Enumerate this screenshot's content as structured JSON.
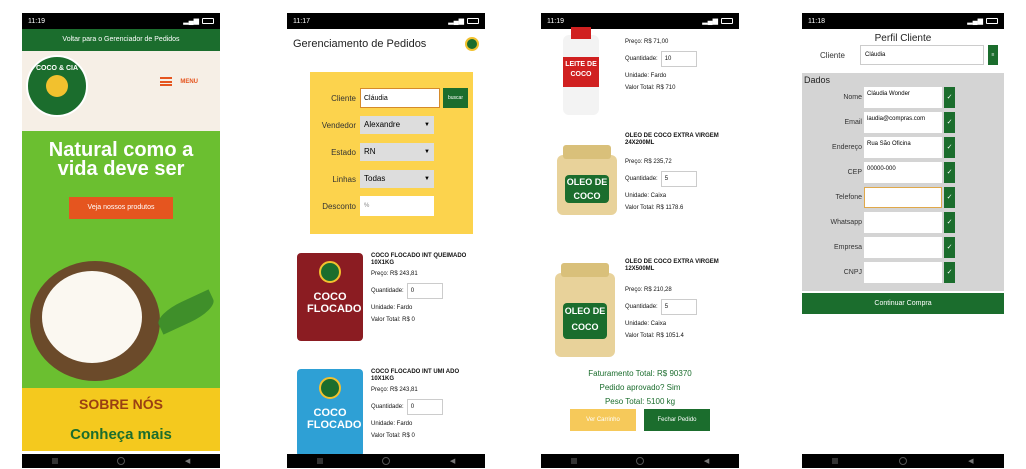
{
  "colors": {
    "brand_green": "#1b6d2d",
    "orange": "#e5551f",
    "yellow": "#fcd34d",
    "lime": "#6bbf30"
  },
  "screen1": {
    "status_time": "11:19",
    "banner": "Voltar para o Gerenciador de Pedidos",
    "logo_text": "COCO & CIA",
    "menu_label": "MENU",
    "headline": "Natural como a vida deve ser",
    "cta": "Veja nossos produtos",
    "sobre": "SOBRE NÓS",
    "conheca": "Conheça mais"
  },
  "screen2": {
    "status_time": "11:17",
    "title": "Gerenciamento de Pedidos",
    "form": {
      "cliente_label": "Cliente",
      "cliente_value": "Cláudia",
      "buscar": "buscar",
      "vendedor_label": "Vendedor",
      "vendedor_value": "Alexandre",
      "estado_label": "Estado",
      "estado_value": "RN",
      "linhas_label": "Linhas",
      "linhas_value": "Todas",
      "desconto_label": "Desconto",
      "desconto_placeholder": "%"
    },
    "products": [
      {
        "name": "COCO FLOCADO INT QUEIMADO 10X1KG",
        "pkg": "COCO FLOCADO",
        "preco": "Preço: R$ 243,81",
        "qtd_label": "Quantidade:",
        "qtd": "0",
        "unidade": "Unidade: Fardo",
        "total": "Valor Total: R$  0"
      },
      {
        "name": "COCO FLOCADO INT UMI ADO 10X1KG",
        "pkg": "COCO FLOCADO",
        "preco": "Preço: R$ 243,81",
        "qtd_label": "Quantidade:",
        "qtd": "0",
        "unidade": "Unidade: Fardo",
        "total": "Valor Total: R$  0"
      }
    ]
  },
  "screen3": {
    "status_time": "11:19",
    "products": [
      {
        "name": "",
        "pkg": "LEITE DE COCO",
        "preco": "Preço: R$ 71,00",
        "qtd_label": "Quantidade:",
        "qtd": "10",
        "unidade": "Unidade: Fardo",
        "total": "Valor Total: R$  710"
      },
      {
        "name": "OLEO DE COCO EXTRA VIRGEM 24X200ML",
        "pkg": "OLEO DE COCO",
        "preco": "Preço: R$ 235,72",
        "qtd_label": "Quantidade:",
        "qtd": "5",
        "unidade": "Unidade: Caixa",
        "total": "Valor Total: R$  1178.6"
      },
      {
        "name": "OLEO DE COCO EXTRA VIRGEM 12X500ML",
        "pkg": "OLEO DE COCO",
        "preco": "Preço: R$ 210,28",
        "qtd_label": "Quantidade:",
        "qtd": "5",
        "unidade": "Unidade: Caixa",
        "total": "Valor Total: R$  1051.4"
      }
    ],
    "faturamento": "Faturamento Total: R$ 90370",
    "aprovado": "Pedido aprovado? Sim",
    "peso": "Peso Total:  5100 kg",
    "ver_carrinho": "Ver Carrinho",
    "fechar_pedido": "Fechar Pedido"
  },
  "screen4": {
    "status_time": "11:18",
    "title": "Perfil Cliente",
    "cliente_label": "Cliente",
    "cliente_value": "Cláudia",
    "dados_label": "Dados",
    "fields": [
      {
        "label": "Nome",
        "value": "Cláudia Wonder"
      },
      {
        "label": "Email",
        "value": "laudia@compras.com"
      },
      {
        "label": "Endereço",
        "value": "Rua São Oficina"
      },
      {
        "label": "CEP",
        "value": "00000-000"
      },
      {
        "label": "Telefone",
        "value": ""
      },
      {
        "label": "Whatsapp",
        "value": ""
      },
      {
        "label": "Empresa",
        "value": ""
      },
      {
        "label": "CNPJ",
        "value": ""
      }
    ],
    "continuar": "Continuar Compra"
  }
}
